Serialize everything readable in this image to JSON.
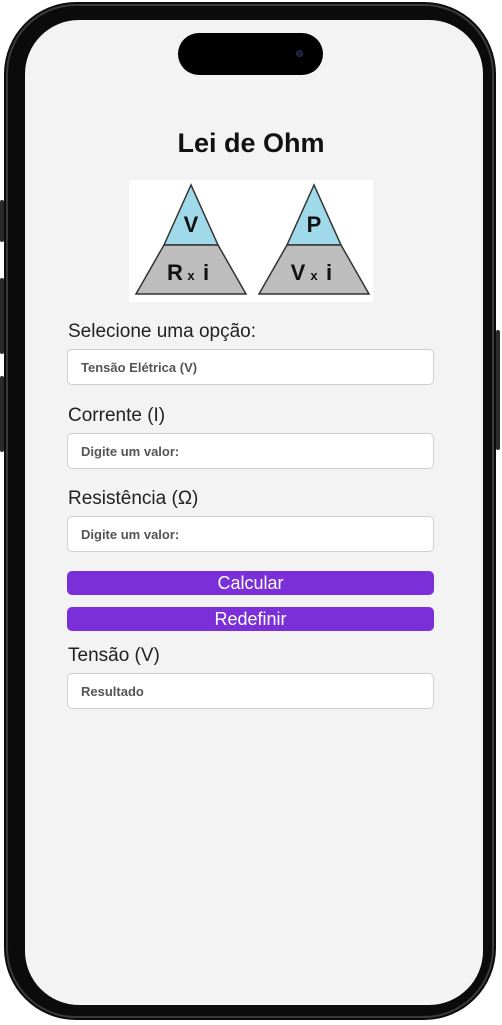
{
  "page": {
    "title": "Lei de Ohm"
  },
  "diagram": {
    "triangle_left": {
      "top": "V",
      "bottom_left": "R",
      "bottom_sep": "x",
      "bottom_right": "i"
    },
    "triangle_right": {
      "top": "P",
      "bottom_left": "V",
      "bottom_sep": "x",
      "bottom_right": "i"
    },
    "colors": {
      "top_fill": "#9fd9ea",
      "bottom_fill": "#bdbdbd",
      "stroke": "#333333"
    }
  },
  "form": {
    "option_label": "Selecione uma opção:",
    "option_selected": "Tensão Elétrica (V)",
    "current_label": "Corrente (I)",
    "current_placeholder": "Digite um valor:",
    "resistance_label": "Resistência (Ω)",
    "resistance_placeholder": "Digite um valor:",
    "calculate_button": "Calcular",
    "reset_button": "Redefinir",
    "result_label": "Tensão (V)",
    "result_placeholder": "Resultado"
  },
  "theme": {
    "accent": "#7b2fd8",
    "background": "#f3f3f3"
  }
}
